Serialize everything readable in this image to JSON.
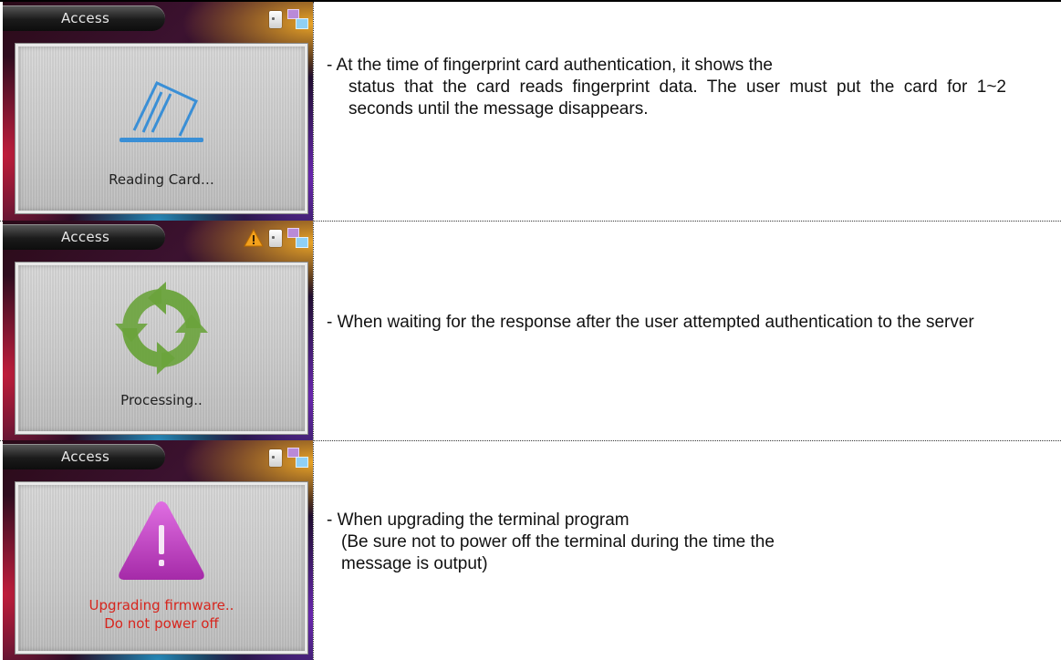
{
  "rows": [
    {
      "screen": {
        "title": "Access",
        "status": "Reading Card…"
      },
      "description": {
        "line1": "- At the time of fingerprint card authentication, it shows the",
        "rest": "status that the card reads fingerprint data. The user must put the card for 1~2 seconds until the message disappears."
      }
    },
    {
      "screen": {
        "title": "Access",
        "status": "Processing.."
      },
      "description": {
        "text": "- When waiting for the response after the user attempted authentication to the server"
      }
    },
    {
      "screen": {
        "title": "Access",
        "status_line1": "Upgrading firmware..",
        "status_line2": "Do not power off"
      },
      "description": {
        "line1": "- When upgrading the terminal program",
        "line2": "(Be sure not to power off the terminal during the time the",
        "line3": "message is output)"
      }
    }
  ],
  "icons": [
    "card-icon",
    "network-icon",
    "warning-icon",
    "reading-card-icon",
    "processing-icon",
    "alert-icon"
  ],
  "colors": {
    "warning_red": "#d7261e",
    "processing_green": "#6aa33c",
    "alert_magenta": "#c13cc4",
    "reader_blue": "#3a8fd6"
  }
}
